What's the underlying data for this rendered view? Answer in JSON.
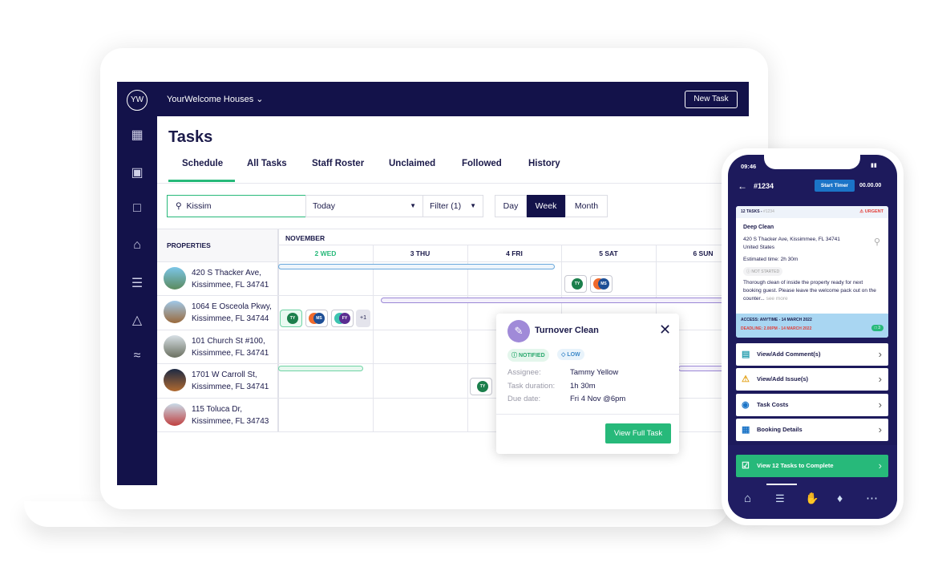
{
  "app": {
    "logo": "YW",
    "org": "YourWelcome Houses",
    "new_task": "New Task",
    "title": "Tasks"
  },
  "tabs": [
    "Schedule",
    "All Tasks",
    "Staff Roster",
    "Unclaimed",
    "Followed",
    "History"
  ],
  "controls": {
    "search_value": "Kissim",
    "date": "Today",
    "filter": "Filter (1)",
    "views": [
      "Day",
      "Week",
      "Month"
    ],
    "active_view": "Week"
  },
  "calendar": {
    "properties_header": "PROPERTIES",
    "month": "NOVEMBER",
    "days": [
      "2 WED",
      "3 THU",
      "4 FRI",
      "5 SAT",
      "6 SUN"
    ],
    "today": "2 WED"
  },
  "properties": [
    {
      "line1": "420 S Thacker Ave,",
      "line2": "Kissimmee, FL 34741"
    },
    {
      "line1": "1064 E Osceola Pkwy,",
      "line2": "Kissimmee, FL 34744"
    },
    {
      "line1": "101 Church St #100,",
      "line2": "Kissimmee, FL 34741"
    },
    {
      "line1": "1701 W Carroll St,",
      "line2": "Kissimmee, FL 34741"
    },
    {
      "line1": "115 Toluca Dr,",
      "line2": "Kissimmee, FL 34743"
    }
  ],
  "avatars": {
    "ty": "TY",
    "ms": "MS",
    "fy": "FY",
    "more": "+1"
  },
  "popover": {
    "title": "Turnover Clean",
    "status": "NOTIFIED",
    "priority": "LOW",
    "assignee_label": "Assignee:",
    "assignee": "Tammy Yellow",
    "duration_label": "Task duration:",
    "duration": "1h 30m",
    "due_label": "Due date:",
    "due": "Fri 4 Nov @6pm",
    "button": "View Full Task"
  },
  "phone": {
    "time": "09:46",
    "task_id": "#1234",
    "start_timer": "Start Timer",
    "timer": "00.00.00",
    "card_header": "12 TASKS - ",
    "card_header_id": "#1234",
    "urgent": "URGENT",
    "task_title": "Deep Clean",
    "address1": "420 S Thacker Ave, Kissimmee, FL 34741",
    "address2": "United States",
    "estimate": "Estimated time: 2h 30m",
    "status": "NOT STARTED",
    "description": "Thorough clean of inside the property ready for next booking guest. Please leave the welcome pack out on the counter...",
    "see_more": "see more",
    "access": "ACCESS: ANYTIME - 14 MARCH 2022",
    "deadline": "DEADLINE: 2.00PM - 14 MARCH 2022",
    "comments_count": "3",
    "menu": [
      "View/Add Comment(s)",
      "View/Add Issue(s)",
      "Task Costs",
      "Booking Details"
    ],
    "cta": "View 12 Tasks to Complete"
  },
  "colors": {
    "navy": "#13124a",
    "green": "#27b97a",
    "purple": "#9b87d6",
    "urgent": "#e2403a"
  }
}
